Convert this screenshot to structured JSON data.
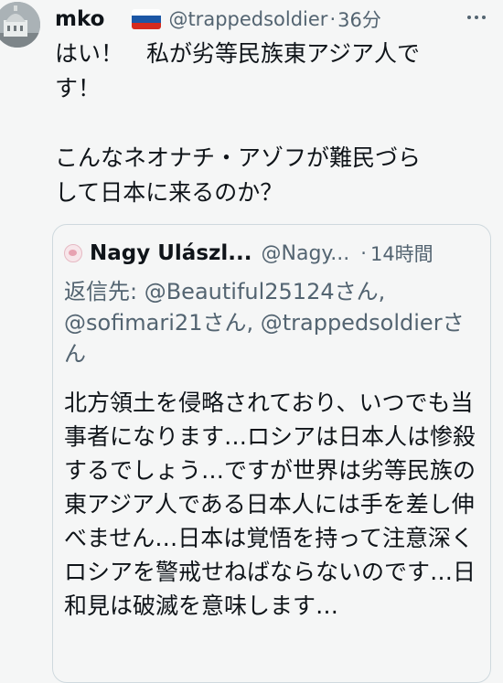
{
  "tweet": {
    "author_name": "mko",
    "handle": "@trappedsoldier",
    "separator": "·",
    "time": "36分",
    "flag_icon": "russia-flag-icon",
    "more_icon": "more-options-icon",
    "text": "はい！　私が劣等民族東アジア人で\nす！\n\nこんなネオナチ・アゾフが難民づら\nして日本に来るのか？"
  },
  "quoted_tweet": {
    "author_name": "Nagy Ulászl...",
    "handle": "@Nagy...",
    "separator": "·",
    "time": "14時間",
    "reply_to": "返信先: @Beautiful25124さん, @sofimari21さん, @trappedsoldierさん",
    "text": "北方領土を侵略されており、いつでも当事者になります…ロシアは日本人は惨殺するでしょう…ですが世界は劣等民族の東アジア人である日本人には手を差し伸べません…日本は覚悟を持って注意深くロシアを警戒せねばならないのです…日和見は破滅を意味します…"
  },
  "colors": {
    "text_primary": "#0f1419",
    "text_secondary": "#536471",
    "border": "#cfd9de",
    "background": "#f5f6f6"
  }
}
